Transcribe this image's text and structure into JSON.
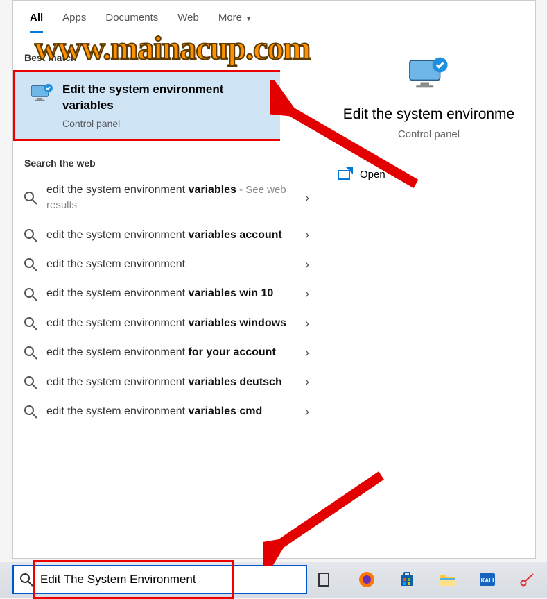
{
  "watermark": "www.mainacup.com",
  "tabs": {
    "all": "All",
    "apps": "Apps",
    "documents": "Documents",
    "web": "Web",
    "more": "More"
  },
  "sections": {
    "best_match": "Best match",
    "web": "Search the web"
  },
  "best_match": {
    "title": "Edit the system environment variables",
    "subtitle": "Control panel"
  },
  "web_results": [
    {
      "prefix": "edit the system environment ",
      "bold": "variables",
      "suffix": " - See web results",
      "suffix_grey": true
    },
    {
      "prefix": "edit the system environment ",
      "bold": "variables account"
    },
    {
      "prefix": "edit the system environment",
      "bold": ""
    },
    {
      "prefix": "edit the system environment ",
      "bold": "variables win 10"
    },
    {
      "prefix": "edit the system environment ",
      "bold": "variables windows"
    },
    {
      "prefix": "edit the system environment ",
      "bold": "for your account"
    },
    {
      "prefix": "edit the system environment ",
      "bold": "variables deutsch"
    },
    {
      "prefix": "edit the system environment ",
      "bold": "variables cmd"
    }
  ],
  "right_panel": {
    "title": "Edit the system environme",
    "subtitle": "Control panel",
    "open": "Open"
  },
  "search_input": "Edit The System Environment",
  "taskbar_icons": [
    "task-view",
    "firefox",
    "ms-store",
    "file-explorer",
    "kali",
    "snip"
  ]
}
